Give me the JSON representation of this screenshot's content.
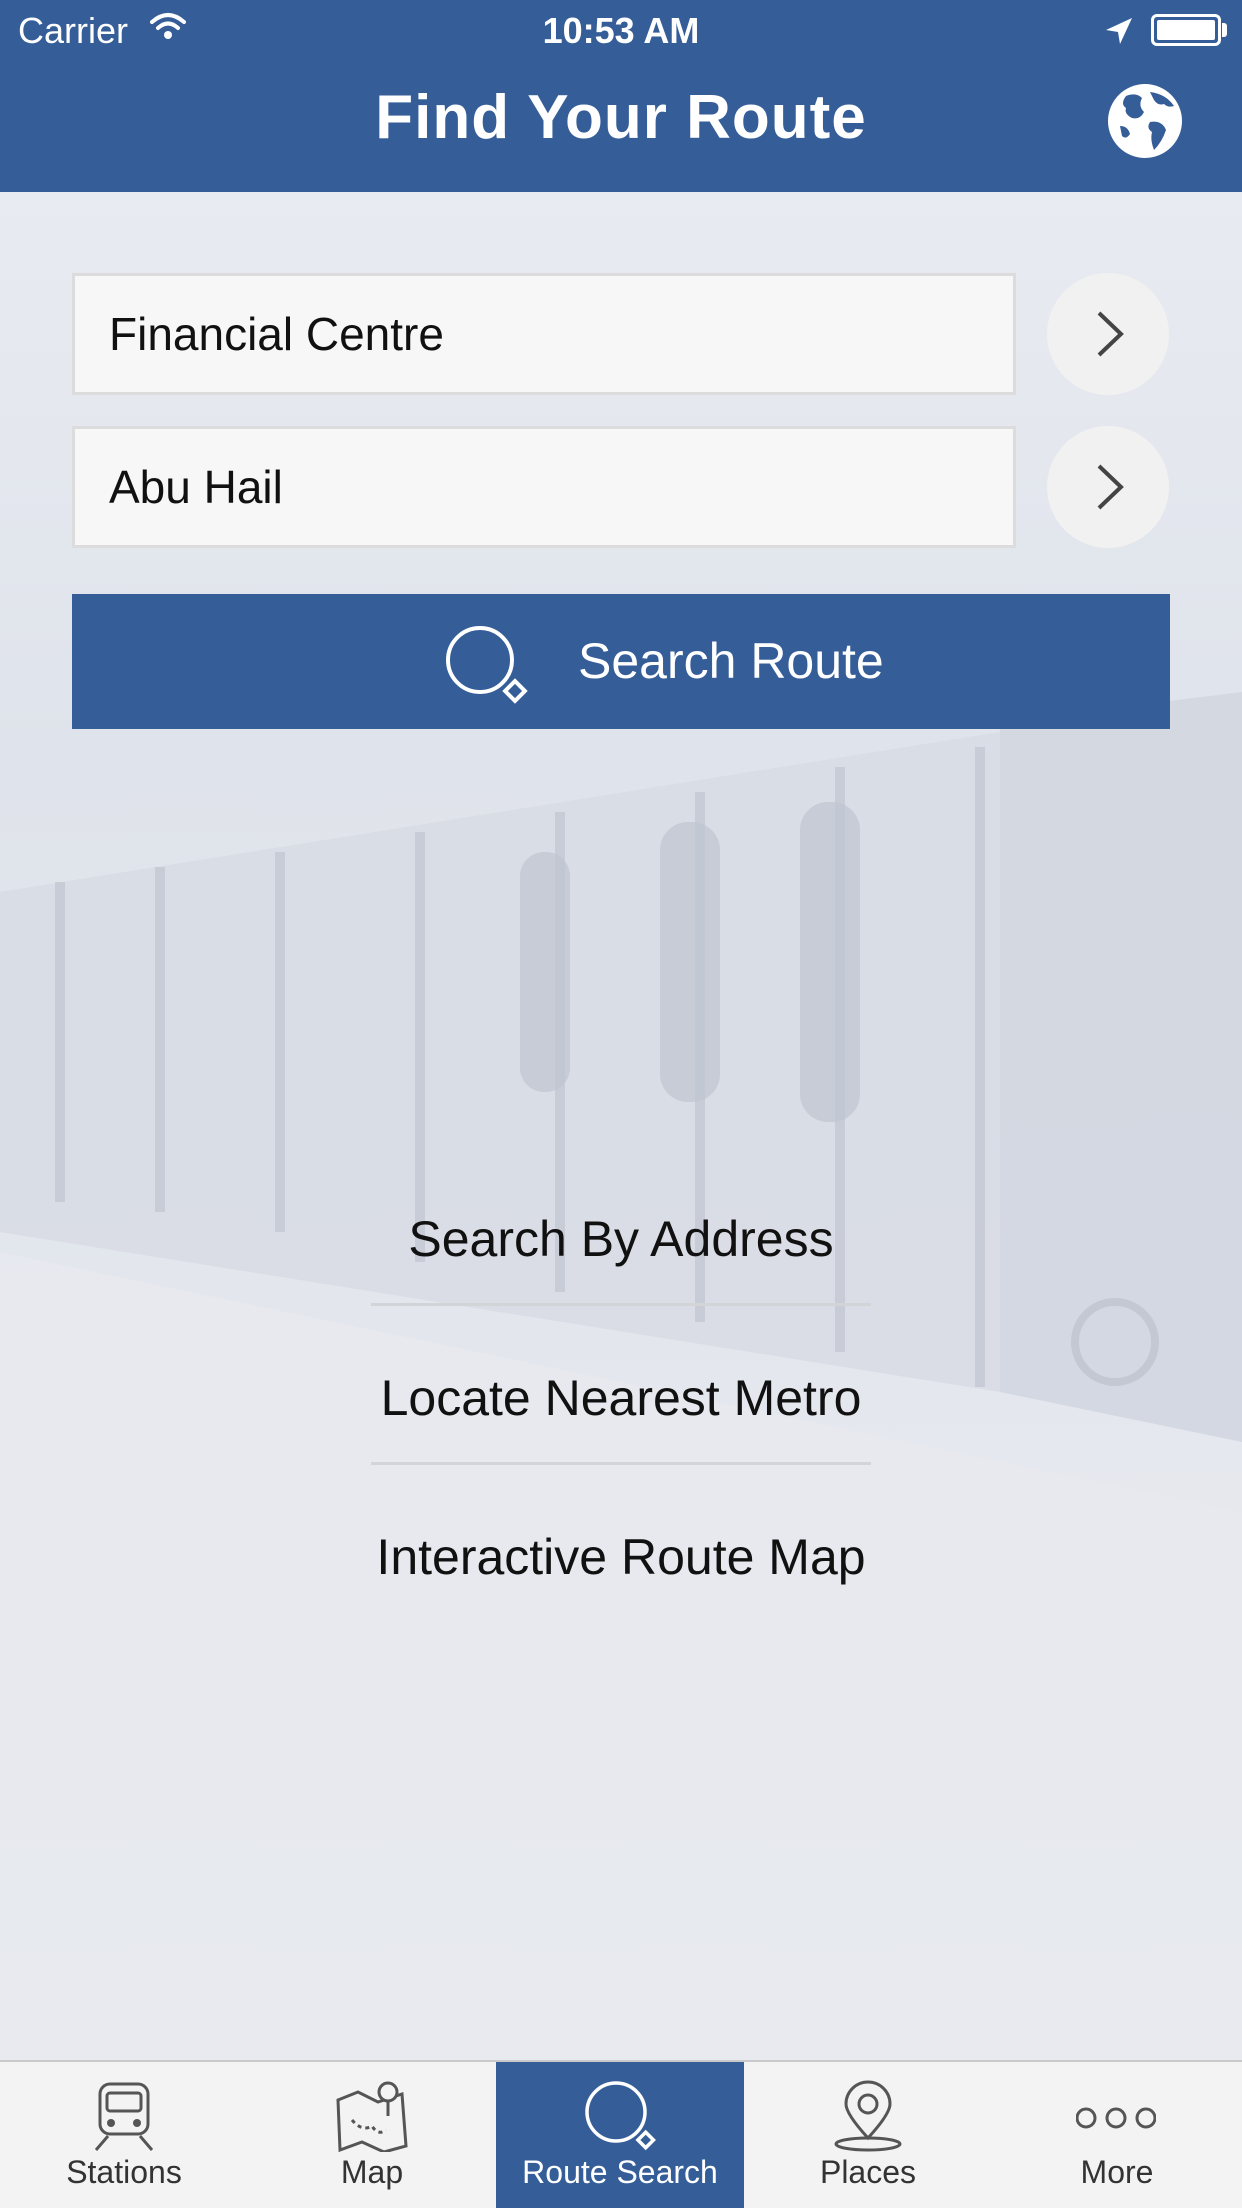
{
  "status_bar": {
    "carrier": "Carrier",
    "time": "10:53 AM"
  },
  "header": {
    "title": "Find Your Route",
    "language_icon": "globe-icon"
  },
  "route_form": {
    "from_value": "Financial Centre",
    "to_value": "Abu Hail",
    "search_label": "Search Route"
  },
  "links": {
    "search_by_address": "Search By Address",
    "locate_nearest_metro": "Locate Nearest Metro",
    "interactive_route_map": "Interactive Route Map"
  },
  "tabbar": {
    "items": [
      {
        "label": "Stations",
        "icon": "train-icon"
      },
      {
        "label": "Map",
        "icon": "map-icon"
      },
      {
        "label": "Route Search",
        "icon": "search-icon"
      },
      {
        "label": "Places",
        "icon": "location-pin-icon"
      },
      {
        "label": "More",
        "icon": "more-icon"
      }
    ],
    "active_index": 2
  },
  "colors": {
    "brand": "#355e99",
    "field_bg": "#f7f7f7",
    "tab_bg": "#f3f3f3"
  }
}
